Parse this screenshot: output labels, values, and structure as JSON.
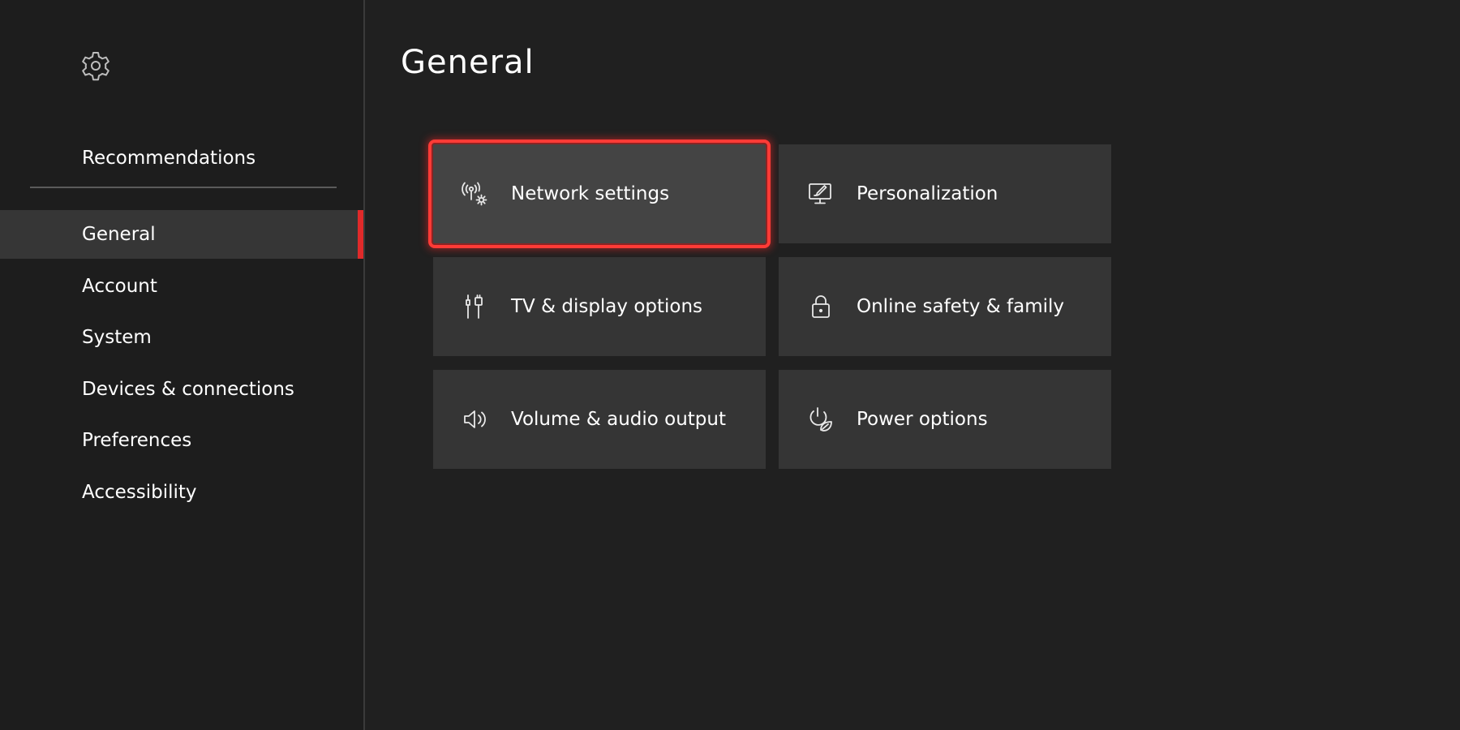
{
  "sidebar": {
    "settings_icon": "gear-icon",
    "recommendations_label": "Recommendations",
    "items": [
      {
        "label": "General",
        "active": true
      },
      {
        "label": "Account",
        "active": false
      },
      {
        "label": "System",
        "active": false
      },
      {
        "label": "Devices & connections",
        "active": false
      },
      {
        "label": "Preferences",
        "active": false
      },
      {
        "label": "Accessibility",
        "active": false
      }
    ],
    "accent_color": "#e02a2a"
  },
  "main": {
    "title": "General",
    "tiles": [
      {
        "label": "Network settings",
        "icon": "network-settings-icon",
        "focused": true
      },
      {
        "label": "Personalization",
        "icon": "personalization-icon",
        "focused": false
      },
      {
        "label": "TV & display options",
        "icon": "display-cable-icon",
        "focused": false
      },
      {
        "label": "Online safety & family",
        "icon": "lock-icon",
        "focused": false
      },
      {
        "label": "Volume & audio output",
        "icon": "speaker-icon",
        "focused": false
      },
      {
        "label": "Power options",
        "icon": "power-leaf-icon",
        "focused": false
      }
    ],
    "focus_color": "#ff3b36"
  }
}
